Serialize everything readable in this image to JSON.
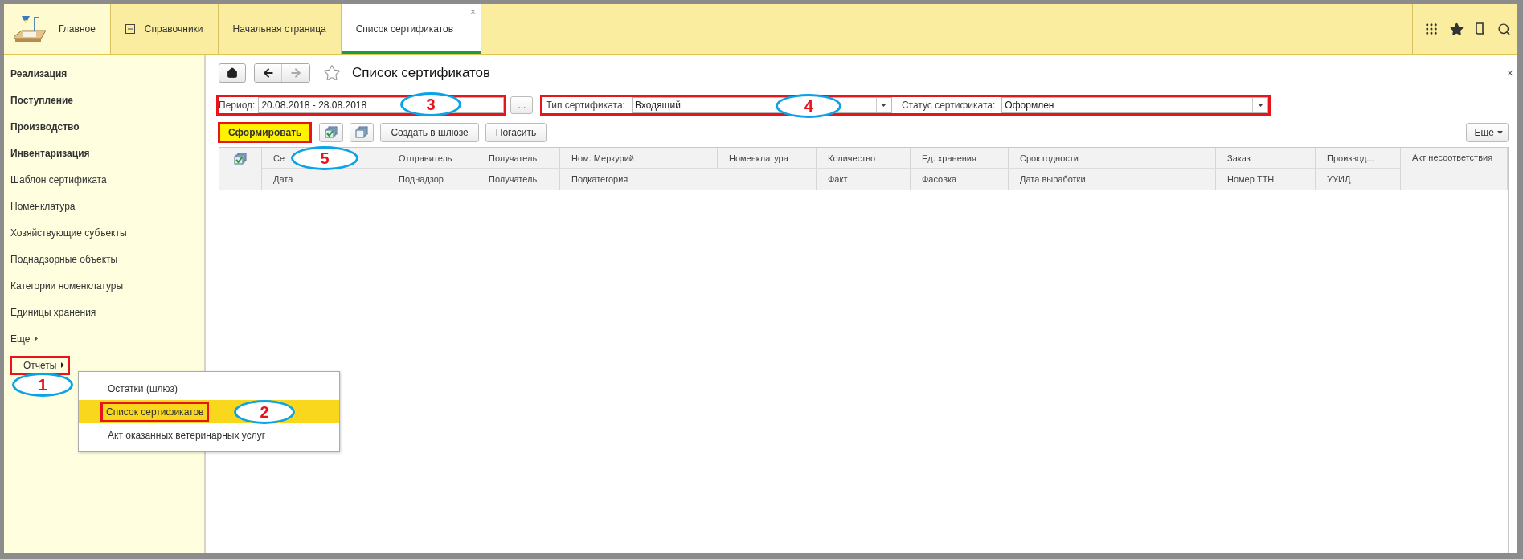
{
  "tabs": [
    {
      "kind": "home",
      "label": "Главное",
      "selected": false
    },
    {
      "kind": "catalog",
      "label": "Справочники",
      "selected": false
    },
    {
      "kind": "plain",
      "label": "Начальная страница",
      "selected": false
    },
    {
      "kind": "closable",
      "label": "Список сертификатов",
      "close": "×",
      "selected": true
    }
  ],
  "sidebar": {
    "items": [
      {
        "kind": "section",
        "label": "Реализация"
      },
      {
        "kind": "section",
        "label": "Поступление"
      },
      {
        "kind": "section",
        "label": "Производство"
      },
      {
        "kind": "section",
        "label": "Инвентаризация"
      },
      {
        "kind": "link",
        "label": "Шаблон сертификата"
      },
      {
        "kind": "link",
        "label": "Номенклатура"
      },
      {
        "kind": "link",
        "label": "Хозяйствующие субъекты"
      },
      {
        "kind": "link",
        "label": "Поднадзорные объекты"
      },
      {
        "kind": "link",
        "label": "Категории номенклатуры"
      },
      {
        "kind": "link",
        "label": "Единицы хранения"
      },
      {
        "kind": "submenu",
        "label": "Еще",
        "expanded": false
      },
      {
        "kind": "submenu",
        "label": "Отчеты",
        "expanded": true,
        "callout": "1",
        "menu": [
          {
            "label": "Остатки (шлюз)",
            "selected": false
          },
          {
            "label": "Список сертификатов",
            "selected": true,
            "callout": "2"
          },
          {
            "label": "Акт оказанных ветеринарных услуг",
            "selected": false
          }
        ]
      }
    ]
  },
  "form": {
    "title": "Список сертификатов",
    "close": "×",
    "period": {
      "label": "Период:",
      "value": "20.08.2018 - 28.08.2018",
      "button": "...",
      "callout": "3"
    },
    "filters": {
      "callout": "4",
      "fields": [
        {
          "label": "Тип сертификата:",
          "value": "Входящий"
        },
        {
          "label": "Статус сертификата:",
          "value": "Оформлен"
        }
      ]
    },
    "commands": [
      {
        "kind": "primary",
        "label": "Сформировать",
        "callout": "5"
      },
      {
        "kind": "icon-check"
      },
      {
        "kind": "icon-copy"
      },
      {
        "kind": "text",
        "label": "Создать в шлюзе"
      },
      {
        "kind": "text",
        "label": "Погасить"
      }
    ],
    "more": "Еще"
  },
  "table": {
    "columns": [
      {
        "kind": "icon"
      },
      {
        "kind": "pair",
        "top": "Се",
        "bottom": "Дата"
      },
      {
        "kind": "pair",
        "top": "Отправитель",
        "bottom": "Поднадзор"
      },
      {
        "kind": "pair",
        "top": "Получатель",
        "bottom": "Получатель"
      },
      {
        "kind": "merged",
        "top": "Ном. Меркурий",
        "bottom": "Подкатегория"
      },
      {
        "kind": "top",
        "top": "Номенклатура"
      },
      {
        "kind": "pair",
        "top": "Количество",
        "bottom": "Факт"
      },
      {
        "kind": "pair",
        "top": "Ед. хранения",
        "bottom": "Фасовка"
      },
      {
        "kind": "pair",
        "top": "Срок годности",
        "bottom": "Дата выработки"
      },
      {
        "kind": "pair",
        "top": "Заказ",
        "bottom": "Номер ТТН"
      },
      {
        "kind": "pair",
        "top": "Производ...",
        "bottom": "УУИД"
      },
      {
        "kind": "tall",
        "top": "Акт несоответствия"
      }
    ]
  }
}
